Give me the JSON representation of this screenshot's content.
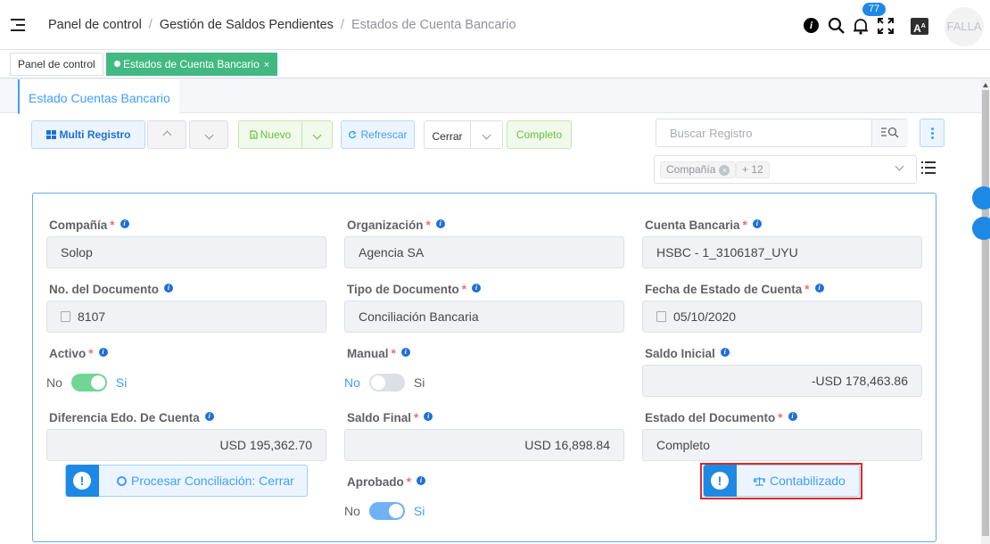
{
  "header": {
    "breadcrumbs": [
      "Panel de control",
      "Gestión de Saldos Pendientes",
      "Estados de Cuenta Bancario"
    ],
    "notification_count": "77",
    "translate_label": "A",
    "avatar_text": "FALLA"
  },
  "tabs": [
    {
      "label": "Panel de control",
      "active": false
    },
    {
      "label": "Estados de Cuenta Bancario",
      "active": true,
      "close": "×"
    }
  ],
  "subtab": {
    "label": "Estado Cuentas Bancario"
  },
  "toolbar": {
    "multi_registro": "Multi Registro",
    "nuevo": "Nuevo",
    "refrescar": "Refrescar",
    "cerrar": "Cerrar",
    "completo": "Completo",
    "search_placeholder": "Buscar Registro"
  },
  "filters": {
    "chips": [
      "Compañía",
      "+ 12"
    ]
  },
  "form": {
    "compania": {
      "label": "Compañía",
      "value": "Solop"
    },
    "organizacion": {
      "label": "Organización",
      "value": "Agencia SA"
    },
    "cuenta_bancaria": {
      "label": "Cuenta Bancaria",
      "value": "HSBC - 1_3106187_UYU"
    },
    "no_documento": {
      "label": "No. del Documento",
      "value": "8107"
    },
    "tipo_documento": {
      "label": "Tipo de Documento",
      "value": "Conciliación Bancaria"
    },
    "fecha_estado": {
      "label": "Fecha de Estado de Cuenta",
      "value": "05/10/2020"
    },
    "activo": {
      "label": "Activo",
      "no": "No",
      "si": "Si",
      "on": true
    },
    "manual": {
      "label": "Manual",
      "no": "No",
      "si": "Si",
      "on": false
    },
    "saldo_inicial": {
      "label": "Saldo Inicial",
      "value": "-USD 178,463.86"
    },
    "diferencia": {
      "label": "Diferencia Edo. De Cuenta",
      "value": "USD 195,362.70"
    },
    "saldo_final": {
      "label": "Saldo Final",
      "value": "USD 16,898.84"
    },
    "estado_documento": {
      "label": "Estado del Documento",
      "value": "Completo"
    },
    "aprobado": {
      "label": "Aprobado",
      "no": "No",
      "si": "Si",
      "on": true
    },
    "procesar_btn": "Procesar Conciliación: Cerrar",
    "contabilizado_btn": "Contabilizado"
  },
  "colors": {
    "accent": "#409eff",
    "active_tab": "#42b983",
    "highlight": "#e12727"
  }
}
